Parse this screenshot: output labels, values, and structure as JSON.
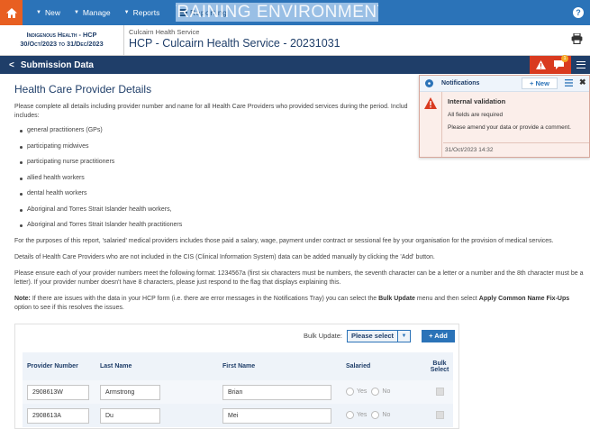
{
  "topbar": {
    "menu": [
      {
        "label": "New"
      },
      {
        "label": "Manage"
      },
      {
        "label": "Reports"
      }
    ],
    "reporting_label": "Reporting",
    "environment_banner": "TRAINING ENVIRONMENT",
    "help_label": "?"
  },
  "org": {
    "program": "Indigenous Health - HCP",
    "period": "30/Oct/2023 to 31/Dec/2023",
    "service_name": "Culcairn Health Service",
    "form_title": "HCP - Culcairn Health Service - 20231031"
  },
  "submission": {
    "title": "Submission Data",
    "notification_badge": "1"
  },
  "page": {
    "title": "Health Care Provider Details",
    "intro": "Please complete all details including provider number and name for all Health Care Providers who provided services during the period. Includ",
    "intro2": "includes:",
    "providers": [
      "general practitioners (GPs)",
      "participating midwives",
      "participating nurse practitioners",
      "allied health workers",
      "dental health workers",
      "Aboriginal and Torres Strait Islander health workers,",
      "Aboriginal and Torres Strait Islander health practitioners"
    ],
    "para_salaried": "For the purposes of this report, 'salaried' medical providers includes those paid a salary, wage, payment under contract or sessional fee by your organisation for the provision of medical services.",
    "para_cis": "Details of Health Care Providers who are not included in the CIS (Clinical Information System) data can be added manually by clicking the 'Add' button.",
    "para_format": "Please ensure each of your provider numbers meet the following format: 1234567a (first six characters must be numbers, the seventh character can be a letter or a number and the 8th character must be a letter). If your provider number doesn't have 8 characters, please just respond to the flag that displays explaining this.",
    "note_label": "Note:",
    "note_text1": " If there are issues with the data in your HCP form (i.e. there are error messages in the Notifications Tray) you can select the ",
    "note_bulk": "Bulk Update",
    "note_text2": " menu and then select ",
    "note_fix": "Apply Common Name Fix-Ups",
    "note_text3": " option to see if this resolves the issues."
  },
  "notifications": {
    "title": "Notifications",
    "new_label": "+ New",
    "items": [
      {
        "title": "Internal validation",
        "line1": "All fields are required",
        "line2": "Please amend your data or provide a comment.",
        "date": "31/Oct/2023 14:32"
      }
    ]
  },
  "table": {
    "bulk_label": "Bulk Update:",
    "bulk_value": "Please select",
    "add_label": "+ Add",
    "headers": [
      "Provider Number",
      "Last Name",
      "First Name",
      "Salaried",
      "Bulk Select"
    ],
    "yes_label": "Yes",
    "no_label": "No",
    "rows": [
      {
        "provider": "2908613W",
        "last": "Armstrong",
        "first": "Brian"
      },
      {
        "provider": "2908613A",
        "last": "Du",
        "first": "Mei"
      }
    ]
  }
}
